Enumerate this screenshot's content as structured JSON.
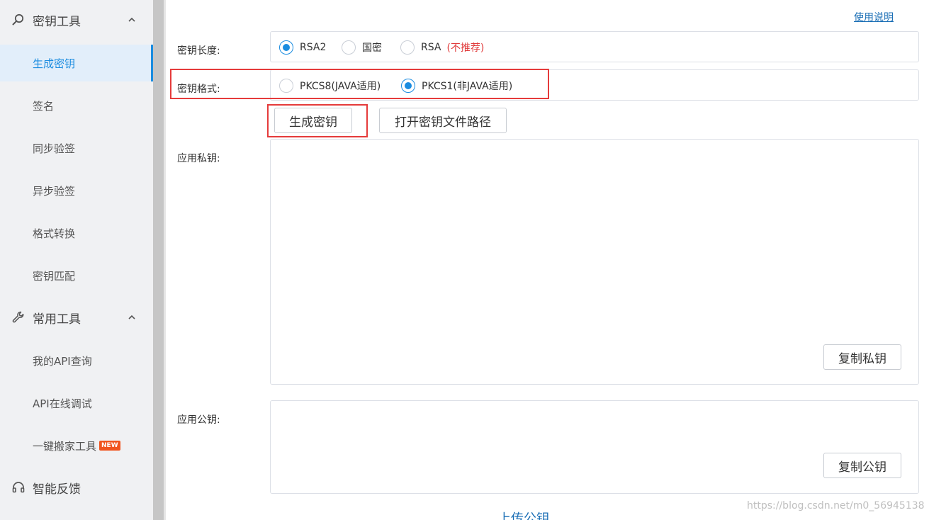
{
  "sidebar": {
    "group1": {
      "label": "密钥工具",
      "icon": "search-icon"
    },
    "group1_items": [
      {
        "label": "生成密钥",
        "active": true
      },
      {
        "label": "签名"
      },
      {
        "label": "同步验签"
      },
      {
        "label": "异步验签"
      },
      {
        "label": "格式转换"
      },
      {
        "label": "密钥匹配"
      }
    ],
    "group2": {
      "label": "常用工具",
      "icon": "wrench-icon"
    },
    "group2_items": [
      {
        "label": "我的API查询"
      },
      {
        "label": "API在线调试"
      },
      {
        "label": "一键搬家工具",
        "badge": "NEW"
      }
    ],
    "group3": {
      "label": "智能反馈",
      "icon": "headset-icon"
    }
  },
  "main": {
    "help_link": "使用说明",
    "key_length": {
      "label": "密钥长度:",
      "options": [
        "RSA2",
        "国密",
        "RSA"
      ],
      "selected": "RSA2",
      "rsa_note": "(不推荐)"
    },
    "key_format": {
      "label": "密钥格式:",
      "options": [
        "PKCS8(JAVA适用)",
        "PKCS1(非JAVA适用)"
      ],
      "selected": "PKCS1(非JAVA适用)"
    },
    "generate_button": "生成密钥",
    "open_path_button": "打开密钥文件路径",
    "private_key": {
      "label": "应用私钥:",
      "value": "",
      "copy_button": "复制私钥"
    },
    "public_key": {
      "label": "应用公钥:",
      "value": "",
      "copy_button": "复制公钥"
    },
    "upload_link": "上传公钥"
  },
  "watermark": "https://blog.csdn.net/m0_56945138",
  "colors": {
    "accent": "#1a8ce0",
    "highlight_box": "#e53b3b",
    "warning_text": "#e03a3a"
  }
}
